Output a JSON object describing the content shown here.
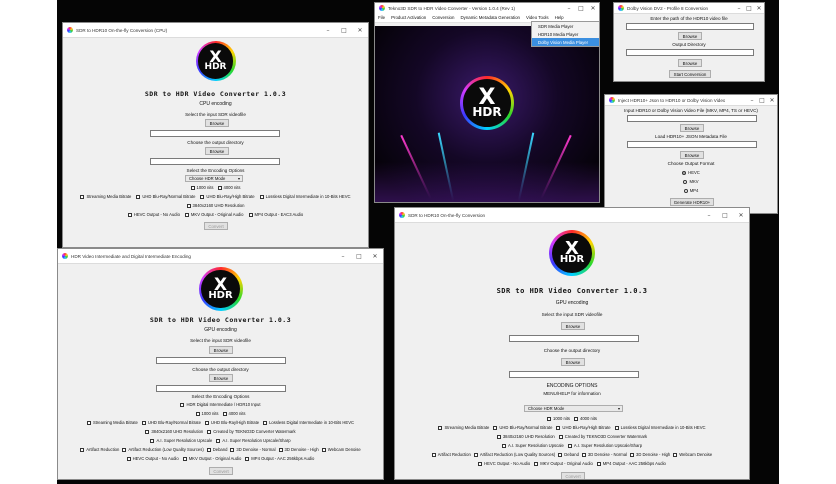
{
  "w1": {
    "title": "SDR to HDR10 On-the-fly Conversion (CPU)",
    "logo_x": "X",
    "logo_hdr": "HDR",
    "heading": "SDR to HDR Video Converter 1.0.3",
    "mode": "CPU encoding",
    "select_input": "Select the input SDR videofile",
    "browse1": "Browse",
    "choose_output": "Choose the output directory",
    "browse2": "Browse",
    "select_encoding": "Select the Encoding Options",
    "hdr_mode": "Choose HDR Mode",
    "nits_1000": "1000 nits",
    "nits_4000": "4000 nits",
    "opt_streaming": "Streaming Media Bitrate",
    "opt_uhd_normal": "UHD Blu-Ray/Normal Bitrate",
    "opt_uhd_high": "UHD Blu-Ray/High Bitrate",
    "opt_lossless": "Lossless Digital Intermediate in 10-Bits HEVC",
    "opt_3840": "3840x2160 UHD Resolution",
    "opt_noaudio": "HEVC Output - No Audio",
    "opt_mkv": "MKV Output - Original Audio",
    "opt_mp4": "MP4 Output - EAC3 Audio",
    "convert": "Convert"
  },
  "w2": {
    "title": "Tekno3D SDR to HDR Video Converter - Version 1.0.4 (Rev 1)",
    "menu": [
      "File",
      "Product Activation",
      "Conversion",
      "Dynamic Metadata Generation",
      "Video Tools",
      "Help"
    ],
    "dropdown": [
      "SDR Media Player",
      "HDR10 Media Player",
      "Dolby Vision Media Player"
    ],
    "logo_x": "X",
    "logo_hdr": "HDR"
  },
  "w3": {
    "title": "Dolby Vision DV2 - Profile 8 Conversion",
    "enter_path": "Enter the path of the HDR10 video file",
    "browse1": "Browse",
    "output_dir": "Output Directory",
    "browse2": "Browse",
    "start": "Start Conversion"
  },
  "w4": {
    "title": "Inject HDR10+ Json to HDR10 or Dolby Vision Video",
    "input_label": "Input HDR10 or Dolby Vision Video File (MKV, MP4, TS or HEVC)",
    "browse1": "Browse",
    "load_label": "Load HDR10+ JSON Metadata File",
    "browse2": "Browse",
    "choose_format": "Choose Output Format",
    "fmt_hevc": "HEVC",
    "fmt_mkv": "MKV",
    "fmt_mp4": "MP4",
    "generate": "Generate HDR10+"
  },
  "w5": {
    "title": "HDR Video Intermediate and Digital Intermediate Encoding",
    "logo_x": "X",
    "logo_hdr": "HDR",
    "heading": "SDR to HDR Video Converter 1.0.3",
    "mode": "GPU encoding",
    "select_input": "Select the input SDR videofile",
    "browse1": "Browse",
    "choose_output": "Choose the output directory",
    "browse2": "Browse",
    "select_encoding": "Select the Encoding Options",
    "opt_hdr_di": "HDR Digital Intermediate / HDR10 Input",
    "nits_1000": "1000 nits",
    "nits_4000": "4000 nits",
    "opt_streaming": "Streaming Media Bitrate",
    "opt_uhd_normal": "UHD Blu-Ray/Normal Bitrate",
    "opt_uhd_high": "UHD Blu-Ray/High Bitrate",
    "opt_lossless": "Lossless Digital Intermediate in 10-Bits HEVC",
    "opt_3840": "3840x2160 UHD Resolution",
    "opt_watermark": "Created by TEKNO3D Converter Watermark",
    "opt_ai_upscale": "A.I. Super Resolution Upscale",
    "opt_ai_sharp": "A.I. Super Resolution Upscale/Sharp",
    "opt_artifact": "Artifact Reduction",
    "opt_artifact_low": "Artifact Reduction (Low Quality Sources)",
    "opt_deband": "Deband",
    "opt_3d_normal": "3D Denoise - Normal",
    "opt_3d_high": "3D Denoise - High",
    "opt_webcam": "Webcam Denoise",
    "opt_noaudio": "HEVC Output - No Audio",
    "opt_mkv": "MKV Output - Original Audio",
    "opt_mp4": "MP4 Output - AAC 256kbps Audio",
    "convert": "Convert"
  },
  "w6": {
    "title": "SDR to HDR10 On-the-fly Conversion",
    "logo_x": "X",
    "logo_hdr": "HDR",
    "heading": "SDR to HDR Video Converter 1.0.3",
    "mode": "GPU encoding",
    "select_input": "Select the input SDR videofile",
    "browse1": "Browse",
    "choose_output": "Choose the output directory",
    "browse2": "Browse",
    "encoding_options": "ENCODING OPTIONS",
    "menu_help": "MENU/HELP for information",
    "hdr_mode": "Choose HDR Mode",
    "nits_1000": "1000 nits",
    "nits_4000": "4000 nits",
    "opt_streaming": "Streaming Media Bitrate",
    "opt_uhd_normal": "UHD Blu-Ray/Normal Bitrate",
    "opt_uhd_high": "UHD Blu-Ray/High Bitrate",
    "opt_lossless": "Lossless Digital Intermediate in 10-Bits HEVC",
    "opt_3840": "3840x2160 UHD Resolution",
    "opt_watermark": "Created by TEKNO3D Converter Watermark",
    "opt_ai_upscale": "A.I. Super Resolution Upscale",
    "opt_ai_sharp": "A.I. Super Resolution Upscale/Sharp",
    "opt_artifact": "Artifact Reduction",
    "opt_artifact_low": "Artifact Reduction (Low Quality Sources)",
    "opt_deband": "Deband",
    "opt_3d_normal": "3D Denoise - Normal",
    "opt_3d_high": "3D Denoise - High",
    "opt_webcam": "Webcam Denoise",
    "opt_noaudio": "HEVC Output - No Audio",
    "opt_mkv": "MKV Output - Original Audio",
    "opt_mp4": "MP4 Output - AAC 256kbps Audio",
    "convert": "Convert"
  },
  "controls": {
    "minimize": "–",
    "maximize": "□",
    "close": "✕"
  },
  "colors": {
    "desktop": "#050505",
    "window": "#f0f0f0",
    "highlight": "#3b8fe0"
  }
}
